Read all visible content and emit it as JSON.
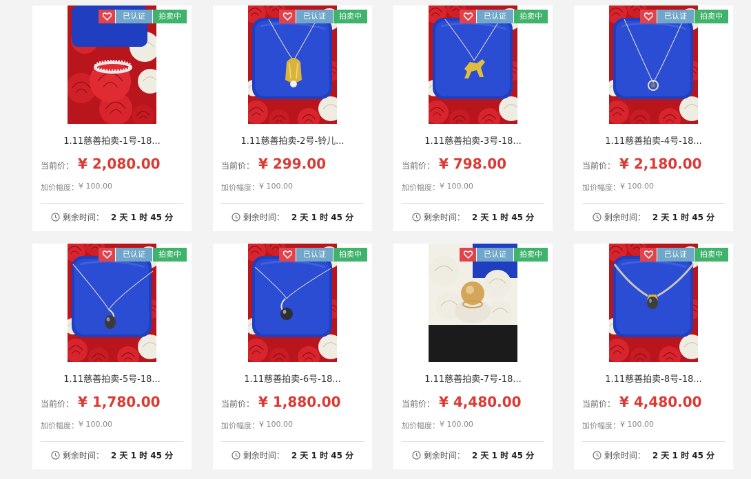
{
  "labels": {
    "verified": "已认证",
    "auction": "拍卖中",
    "current_price": "当前价：",
    "increment": "加价幅度：",
    "remaining": "剩余时间："
  },
  "items": [
    {
      "title": "1.11慈善拍卖-1号-18...",
      "price": "¥ 2,080.00",
      "increment": "¥ 100.00",
      "time_left": "2 天 1 时 45 分",
      "photo": "ring-on-roses"
    },
    {
      "title": "1.11慈善拍卖-2号-铃儿...",
      "price": "¥ 299.00",
      "increment": "¥ 100.00",
      "time_left": "2 天 1 时 45 分",
      "photo": "bell-pendant"
    },
    {
      "title": "1.11慈善拍卖-3号-18...",
      "price": "¥ 798.00",
      "increment": "¥ 100.00",
      "time_left": "2 天 1 时 45 分",
      "photo": "horse-pendant"
    },
    {
      "title": "1.11慈善拍卖-4号-18...",
      "price": "¥ 2,180.00",
      "increment": "¥ 100.00",
      "time_left": "2 天 1 时 45 分",
      "photo": "ring-pendant"
    },
    {
      "title": "1.11慈善拍卖-5号-18...",
      "price": "¥ 1,780.00",
      "increment": "¥ 100.00",
      "time_left": "2 天 1 时 45 分",
      "photo": "dark-pearl-pendant"
    },
    {
      "title": "1.11慈善拍卖-6号-18...",
      "price": "¥ 1,880.00",
      "increment": "¥ 100.00",
      "time_left": "2 天 1 时 45 分",
      "photo": "black-pearl-pendant"
    },
    {
      "title": "1.11慈善拍卖-7号-18...",
      "price": "¥ 4,480.00",
      "increment": "¥ 100.00",
      "time_left": "2 天 1 时 45 分",
      "photo": "gold-pearl-ring"
    },
    {
      "title": "1.11慈善拍卖-8号-18...",
      "price": "¥ 4,480.00",
      "increment": "¥ 100.00",
      "time_left": "2 天 1 时 45 分",
      "photo": "pearl-necklace"
    }
  ],
  "colors": {
    "price": "#d93a34",
    "heart_badge": "#e0434b",
    "verified_badge": "#6fa6c9",
    "auction_badge": "#3fb36b",
    "rose": "#d8242c",
    "box_blue": "#1f3fc0"
  }
}
